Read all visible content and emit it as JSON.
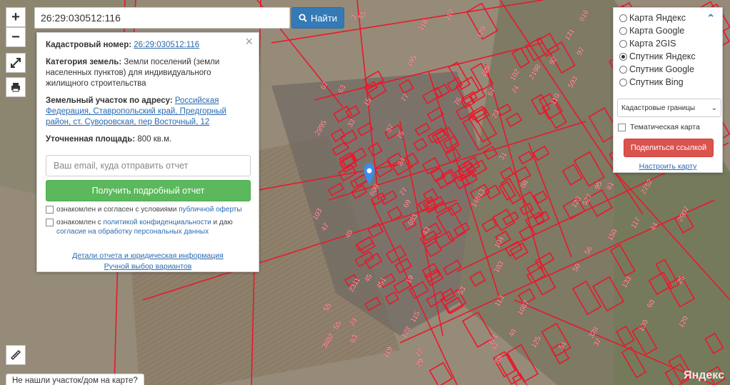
{
  "search": {
    "value": "26:29:030512:116",
    "button_label": "Найти"
  },
  "zoom": {
    "in_label": "+",
    "out_label": "−"
  },
  "parcel": {
    "cadastral_label": "Кадастровый номер:",
    "cadastral_value": "26:29:030512:116",
    "category_label": "Категория земель:",
    "category_value": "Земли поселений (земли населенных пунктов) для индивидуального жилищного строительства",
    "address_label": "Земельный участок по адресу:",
    "address_value": "Российская Федерация, Ставропольский край, Предгорный район, ст. Суворовская, пер Восточный, 12",
    "area_label": "Уточненная площадь:",
    "area_value": "800 кв.м.",
    "email_placeholder": "Ваш email, куда отправить отчет",
    "report_button": "Получить подробный отчет",
    "consent1_prefix": "ознакомлен и согласен с условиями ",
    "consent1_link": "публичной оферты",
    "consent2_prefix": "ознакомлен с ",
    "consent2_link": "политикой конфиденциальности",
    "consent2_mid": " и даю ",
    "consent2_link2": "согласие на обработку персональных данных",
    "details_link": "Детали отчета и юридическая информация",
    "manual_link": "Ручной выбор вариантов"
  },
  "layers": {
    "options": [
      {
        "label": "Карта Яндекс",
        "selected": false
      },
      {
        "label": "Карта Google",
        "selected": false
      },
      {
        "label": "Карта 2GIS",
        "selected": false
      },
      {
        "label": "Спутник Яндекс",
        "selected": true
      },
      {
        "label": "Спутник Google",
        "selected": false
      },
      {
        "label": "Спутник Bing",
        "selected": false
      }
    ],
    "select_value": "Кадастровые границы",
    "thematic_label": "Тематическая карта",
    "share_button": "Поделиться ссылкой",
    "setup_link": "Настроить карту"
  },
  "bottom_bar": "Не нашли участок/дом на карте?",
  "provider": "Яндекс",
  "map_labels": [
    "2752",
    "66",
    "2198",
    "885",
    "527",
    "2311",
    "1025",
    "126",
    "110",
    "34",
    "31",
    "47",
    "37",
    "55",
    "21",
    "55",
    "109",
    "23",
    "25",
    "33",
    "43",
    "88",
    "118",
    "81",
    "69",
    "123",
    "77",
    "76",
    "92",
    "67",
    "72",
    "124",
    "103",
    "29",
    "89",
    "116",
    "56",
    "55",
    "50",
    "41",
    "74",
    "24",
    "75",
    "87",
    "48",
    "38",
    "14613",
    "105",
    "104",
    "102",
    "51",
    "40",
    "117",
    "47",
    "15",
    "97",
    "95",
    "120",
    "120",
    "63",
    "60",
    "53",
    "67",
    "84",
    "44",
    "45",
    "112",
    "115",
    "113",
    "125",
    "130",
    "133",
    "77",
    "125",
    "121",
    "131",
    "103",
    "150",
    "119",
    "128",
    "63",
    "609",
    "2895",
    "816",
    "1113",
    "593",
    "347",
    "328",
    "1087",
    "683",
    "652",
    "2907",
    "2906",
    "3882",
    "19",
    "3",
    "451"
  ],
  "colors": {
    "parcel": "#e8192c",
    "search_button": "#337ab7",
    "report_button": "#5cb85c",
    "share_button": "#d9534f",
    "link": "#2a6ab0"
  }
}
